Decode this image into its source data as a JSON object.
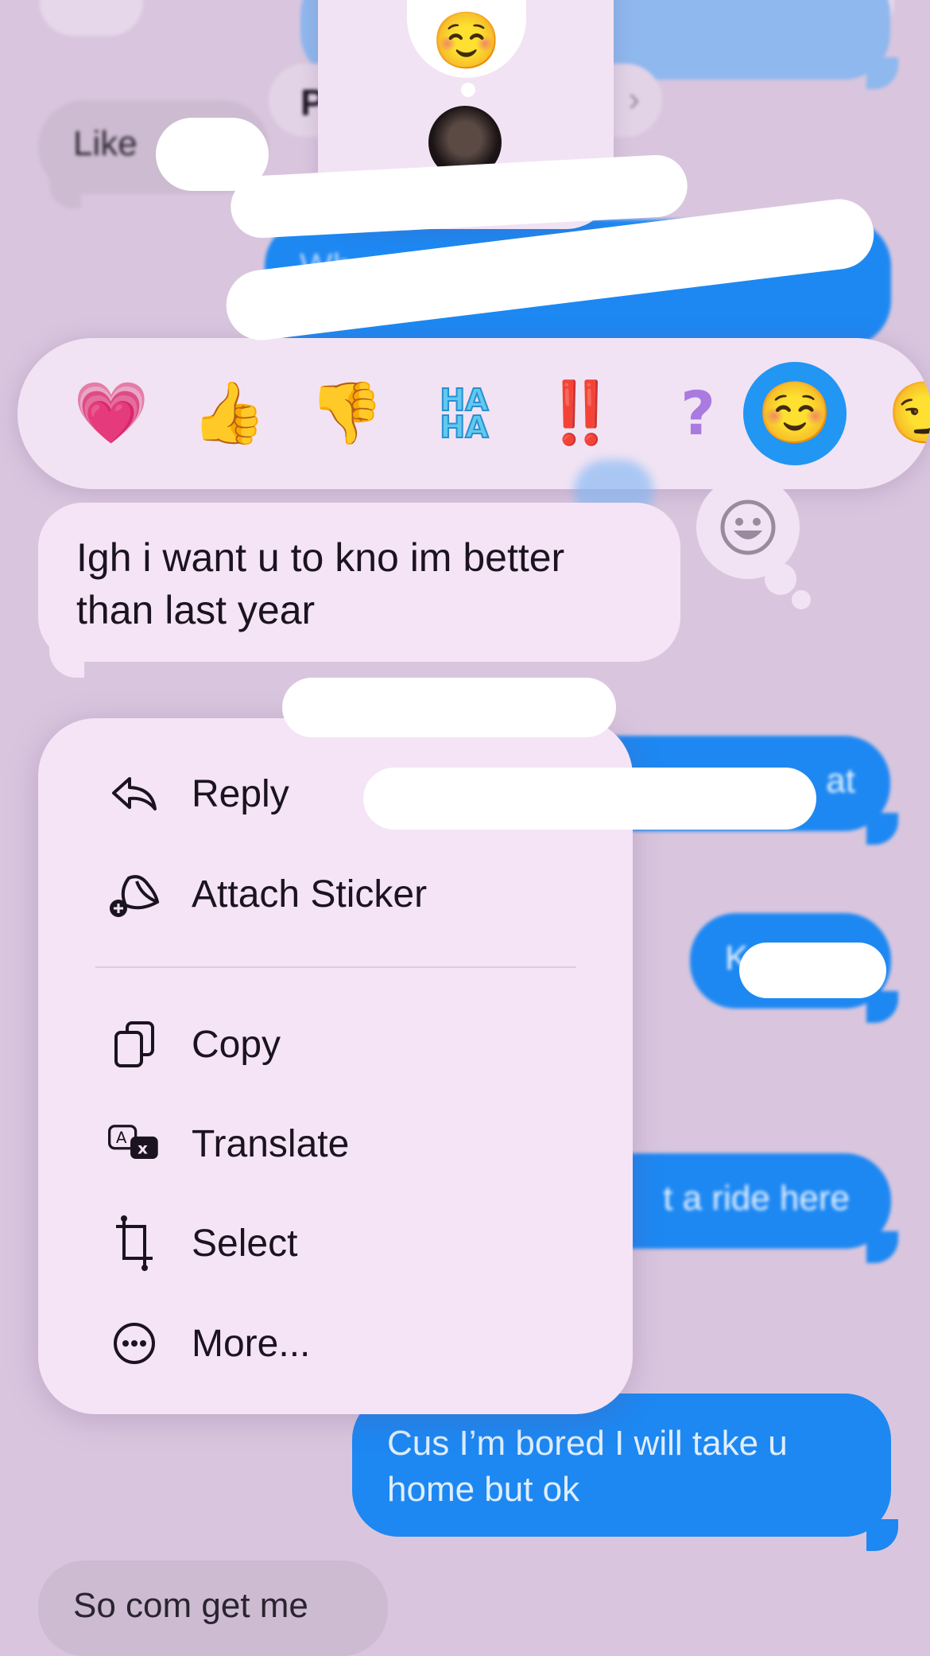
{
  "thread": {
    "incoming_top": "Like",
    "outgoing_partial_1": "Wh",
    "outgoing_partial_2": "at",
    "outgoing_partial_3": "K",
    "outgoing_partial_4": "t a ride here",
    "outgoing_last": "Cus I’m bored I will take u home but ok",
    "incoming_bottom": "So com get me",
    "pill_initial": "P"
  },
  "selected_message": {
    "text": "Igh i want u to kno im better than last year"
  },
  "reactions": {
    "items": [
      {
        "name": "heart",
        "glyph": "💗"
      },
      {
        "name": "thumbs-up",
        "glyph": "👍"
      },
      {
        "name": "thumbs-down",
        "glyph": "👎"
      },
      {
        "name": "haha",
        "glyph": "HA HA"
      },
      {
        "name": "exclamation",
        "glyph": "‼️"
      },
      {
        "name": "question",
        "glyph": "?"
      },
      {
        "name": "smiling-blush",
        "glyph": "☺️"
      },
      {
        "name": "more-emoji",
        "glyph": "😏"
      }
    ],
    "selected": "smiling-blush",
    "selected_color": "#2196f3"
  },
  "context_menu": {
    "items": [
      {
        "id": "reply",
        "label": "Reply",
        "icon": "reply-icon"
      },
      {
        "id": "attach-sticker",
        "label": "Attach Sticker",
        "icon": "sticker-icon"
      },
      {
        "id": "copy",
        "label": "Copy",
        "icon": "copy-icon"
      },
      {
        "id": "translate",
        "label": "Translate",
        "icon": "translate-icon"
      },
      {
        "id": "select",
        "label": "Select",
        "icon": "crop-select-icon"
      },
      {
        "id": "more",
        "label": "More...",
        "icon": "ellipsis-circle-icon"
      }
    ]
  },
  "colors": {
    "background": "#d9c6de",
    "outgoing_bubble": "#1d88f2",
    "incoming_bubble": "#cdbbd1",
    "menu_background": "#f4e4f6"
  }
}
